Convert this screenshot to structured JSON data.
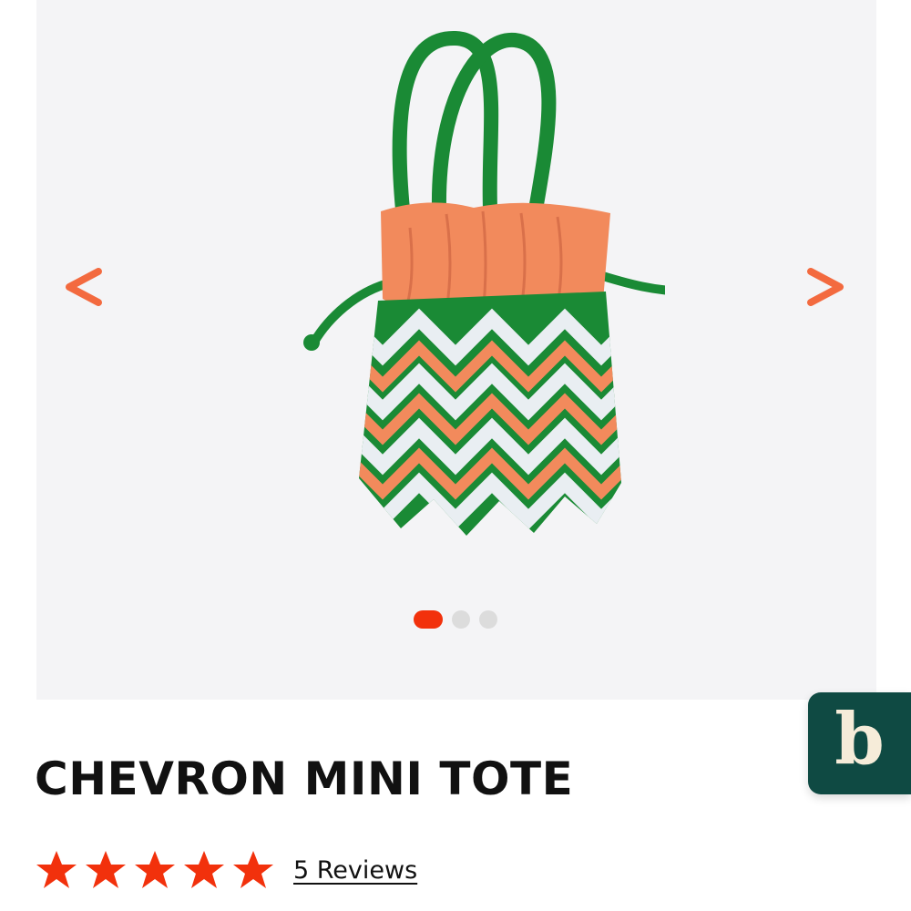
{
  "gallery": {
    "prev_icon": "chevron-left-icon",
    "next_icon": "chevron-right-icon",
    "slide_count": 3,
    "active_slide": 1
  },
  "brand_badge": {
    "letter": "b"
  },
  "product": {
    "title": "CHEVRON MINI TOTE",
    "rating": 5,
    "reviews_label": "5 Reviews"
  },
  "colors": {
    "accent": "#f2310c",
    "arrow": "#f36a3f",
    "bag_green": "#1a8a35",
    "bag_orange": "#f28a5c",
    "bag_white": "#e9eef2",
    "badge_bg": "#0f4a43",
    "gallery_bg": "#f4f4f6"
  }
}
